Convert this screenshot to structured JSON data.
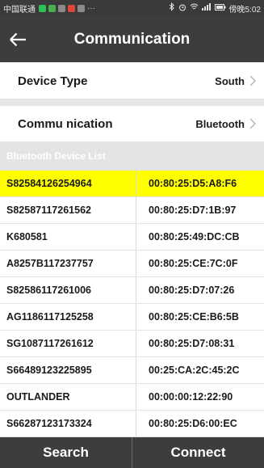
{
  "status_bar": {
    "carrier": "中国联通",
    "more": "···",
    "right_text": "傍晚5:02"
  },
  "header": {
    "title": "Communication"
  },
  "settings": {
    "device_type": {
      "label": "Device Type",
      "value": "South"
    },
    "communication": {
      "label": "Commu nication",
      "value": "Bluetooth"
    }
  },
  "list": {
    "header": "Bluetooth Device List",
    "devices": [
      {
        "name": "S82584126254964",
        "mac": "00:80:25:D5:A8:F6",
        "selected": true
      },
      {
        "name": "S82587117261562",
        "mac": "00:80:25:D7:1B:97",
        "selected": false
      },
      {
        "name": "K680581",
        "mac": "00:80:25:49:DC:CB",
        "selected": false
      },
      {
        "name": "A8257B117237757",
        "mac": "00:80:25:CE:7C:0F",
        "selected": false
      },
      {
        "name": "S82586117261006",
        "mac": "00:80:25:D7:07:26",
        "selected": false
      },
      {
        "name": "AG1186117125258",
        "mac": "00:80:25:CE:B6:5B",
        "selected": false
      },
      {
        "name": "SG1087117261612",
        "mac": "00:80:25:D7:08:31",
        "selected": false
      },
      {
        "name": "S66489123225895",
        "mac": "00:25:CA:2C:45:2C",
        "selected": false
      },
      {
        "name": "OUTLANDER",
        "mac": "00:00:00:12:22:90",
        "selected": false
      },
      {
        "name": "S66287123173324",
        "mac": "00:80:25:D6:00:EC",
        "selected": false
      }
    ]
  },
  "footer": {
    "search_label": "Search",
    "connect_label": "Connect"
  },
  "colors": {
    "selected_row": "#ffff00",
    "bar_background": "#3d3d3d"
  }
}
